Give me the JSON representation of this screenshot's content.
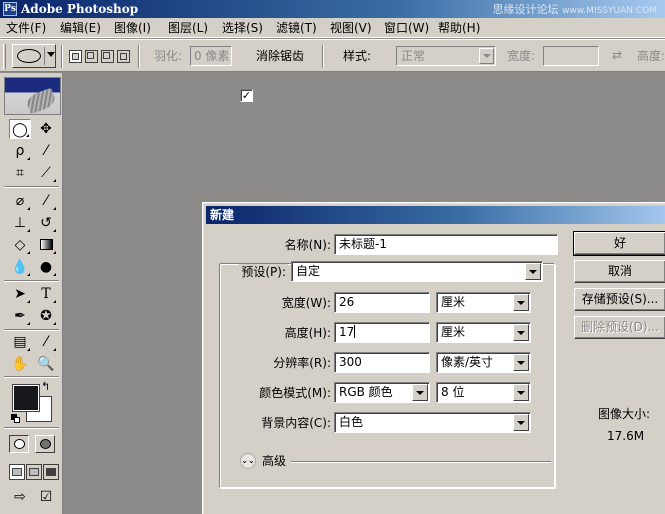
{
  "app": {
    "title": "Adobe Photoshop",
    "icon_label": "Ps",
    "watermark": "思缘设计论坛",
    "watermark_url": "www.MISSYUAN.COM"
  },
  "menu": [
    "文件(F)",
    "编辑(E)",
    "图像(I)",
    "图层(L)",
    "选择(S)",
    "滤镜(T)",
    "视图(V)",
    "窗口(W)",
    "帮助(H)"
  ],
  "options": {
    "feather_label": "羽化:",
    "feather_value": "0 像素",
    "antialias_label": "消除锯齿",
    "antialias_checked": "✓",
    "style_label": "样式:",
    "style_value": "正常",
    "width_label": "宽度:",
    "height_label": "高度:",
    "swap_icon": "⇄"
  },
  "toolbox": {
    "tools": [
      "marquee-icon",
      "move-icon",
      "lasso-icon",
      "magic-wand-icon",
      "crop-icon",
      "slice-icon",
      "healing-brush-icon",
      "brush-icon",
      "stamp-icon",
      "history-brush-icon",
      "eraser-icon",
      "gradient-icon",
      "blur-icon",
      "dodge-icon",
      "path-select-icon",
      "type-icon",
      "pen-icon",
      "shape-icon",
      "notes-icon",
      "eyedropper-icon",
      "hand-icon",
      "zoom-icon"
    ],
    "foreground_color": "#15171a",
    "background_color": "#ffffff"
  },
  "dialog": {
    "title": "新建",
    "name_label": "名称(N):",
    "name_value": "未标题-1",
    "preset_label": "预设(P):",
    "preset_value": "自定",
    "width_label": "宽度(W):",
    "width_value": "26",
    "width_unit": "厘米",
    "height_label": "高度(H):",
    "height_value": "17",
    "height_unit": "厘米",
    "resolution_label": "分辨率(R):",
    "resolution_value": "300",
    "resolution_unit": "像素/英寸",
    "color_mode_label": "颜色模式(M):",
    "color_mode_value": "RGB 颜色",
    "bit_depth_value": "8 位",
    "background_label": "背景内容(C):",
    "background_value": "白色",
    "advanced_label": "高级",
    "ok_label": "好",
    "cancel_label": "取消",
    "save_preset_label": "存储预设(S)...",
    "delete_preset_label": "删除预设(D)...",
    "image_size_label": "图像大小:",
    "image_size_value": "17.6M"
  }
}
